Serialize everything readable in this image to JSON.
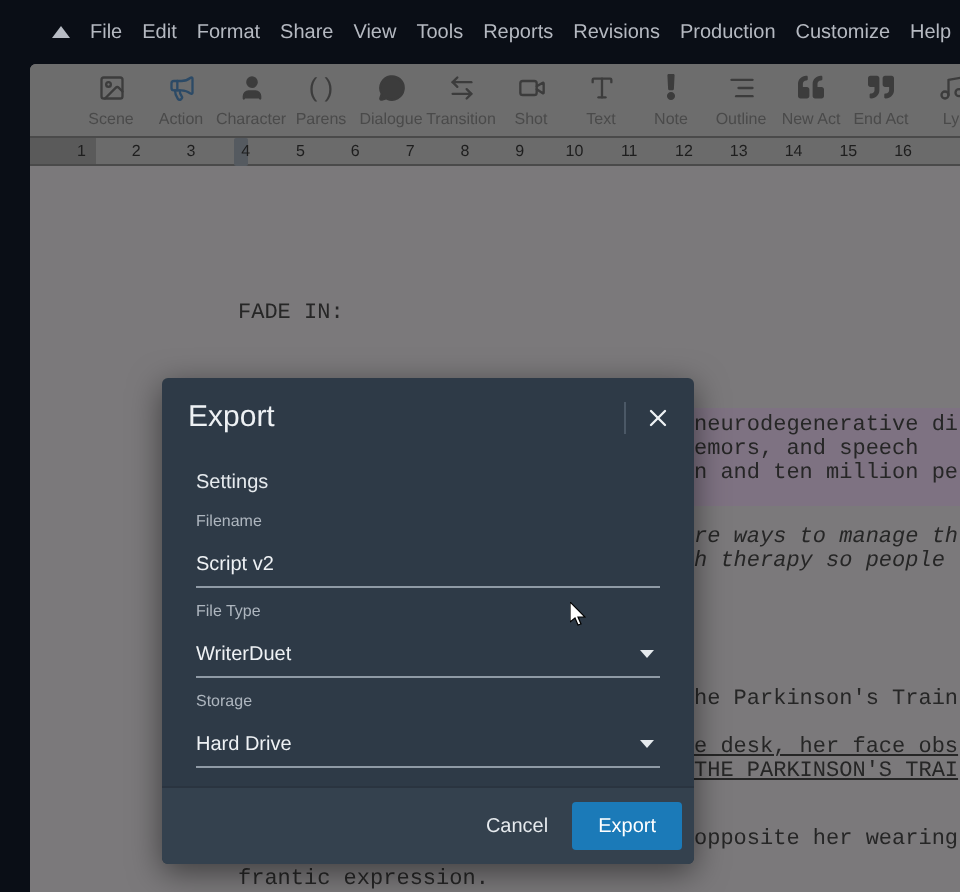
{
  "menu": {
    "items": [
      "File",
      "Edit",
      "Format",
      "Share",
      "View",
      "Tools",
      "Reports",
      "Revisions",
      "Production",
      "Customize",
      "Help"
    ]
  },
  "toolbar": {
    "items": [
      {
        "kind": "icon",
        "label": "Scene"
      },
      {
        "kind": "icon",
        "label": "Action"
      },
      {
        "kind": "icon",
        "label": "Character"
      },
      {
        "kind": "glyph",
        "glyph": "( )",
        "label": "Parens"
      },
      {
        "kind": "icon",
        "label": "Dialogue"
      },
      {
        "kind": "icon",
        "label": "Transition"
      },
      {
        "kind": "icon",
        "label": "Shot"
      },
      {
        "kind": "icon",
        "label": "Text"
      },
      {
        "kind": "icon",
        "label": "Note"
      },
      {
        "kind": "icon",
        "label": "Outline"
      },
      {
        "kind": "icon",
        "label": "New Act"
      },
      {
        "kind": "icon",
        "label": "End Act"
      },
      {
        "kind": "icon",
        "label": "Ly"
      }
    ]
  },
  "ruler": {
    "numbers": [
      "1",
      "2",
      "3",
      "4",
      "5",
      "6",
      "7",
      "8",
      "9",
      "10",
      "11",
      "12",
      "13",
      "14",
      "15",
      "16"
    ]
  },
  "script": {
    "lines": [
      {
        "kind": "plain",
        "text": "FADE IN:"
      },
      {
        "kind": "highlight",
        "text": "neurodegenerative di"
      },
      {
        "kind": "highlight",
        "text": "emors, and speech"
      },
      {
        "kind": "highlight",
        "text": "n and ten million pe"
      },
      {
        "kind": "italic",
        "text": "re ways to manage th"
      },
      {
        "kind": "italic",
        "text": "h therapy so people"
      },
      {
        "kind": "plain",
        "text": "he Parkinson's Train"
      },
      {
        "kind": "underline",
        "text": "e desk, her face obs"
      },
      {
        "kind": "underline",
        "text": "THE PARKINSON'S TRAI"
      },
      {
        "kind": "plain",
        "text": "opposite her wearing"
      },
      {
        "kind": "plain",
        "text": "frantic expression."
      }
    ]
  },
  "dialog": {
    "title": "Export",
    "section": "Settings",
    "fields": [
      {
        "kind": "text",
        "label": "Filename",
        "value": "Script v2"
      },
      {
        "kind": "select",
        "label": "File Type",
        "value": "WriterDuet"
      },
      {
        "kind": "select",
        "label": "Storage",
        "value": "Hard Drive"
      }
    ],
    "buttons": [
      {
        "kind": "secondary",
        "label": "Cancel"
      },
      {
        "kind": "primary",
        "label": "Export"
      }
    ]
  }
}
